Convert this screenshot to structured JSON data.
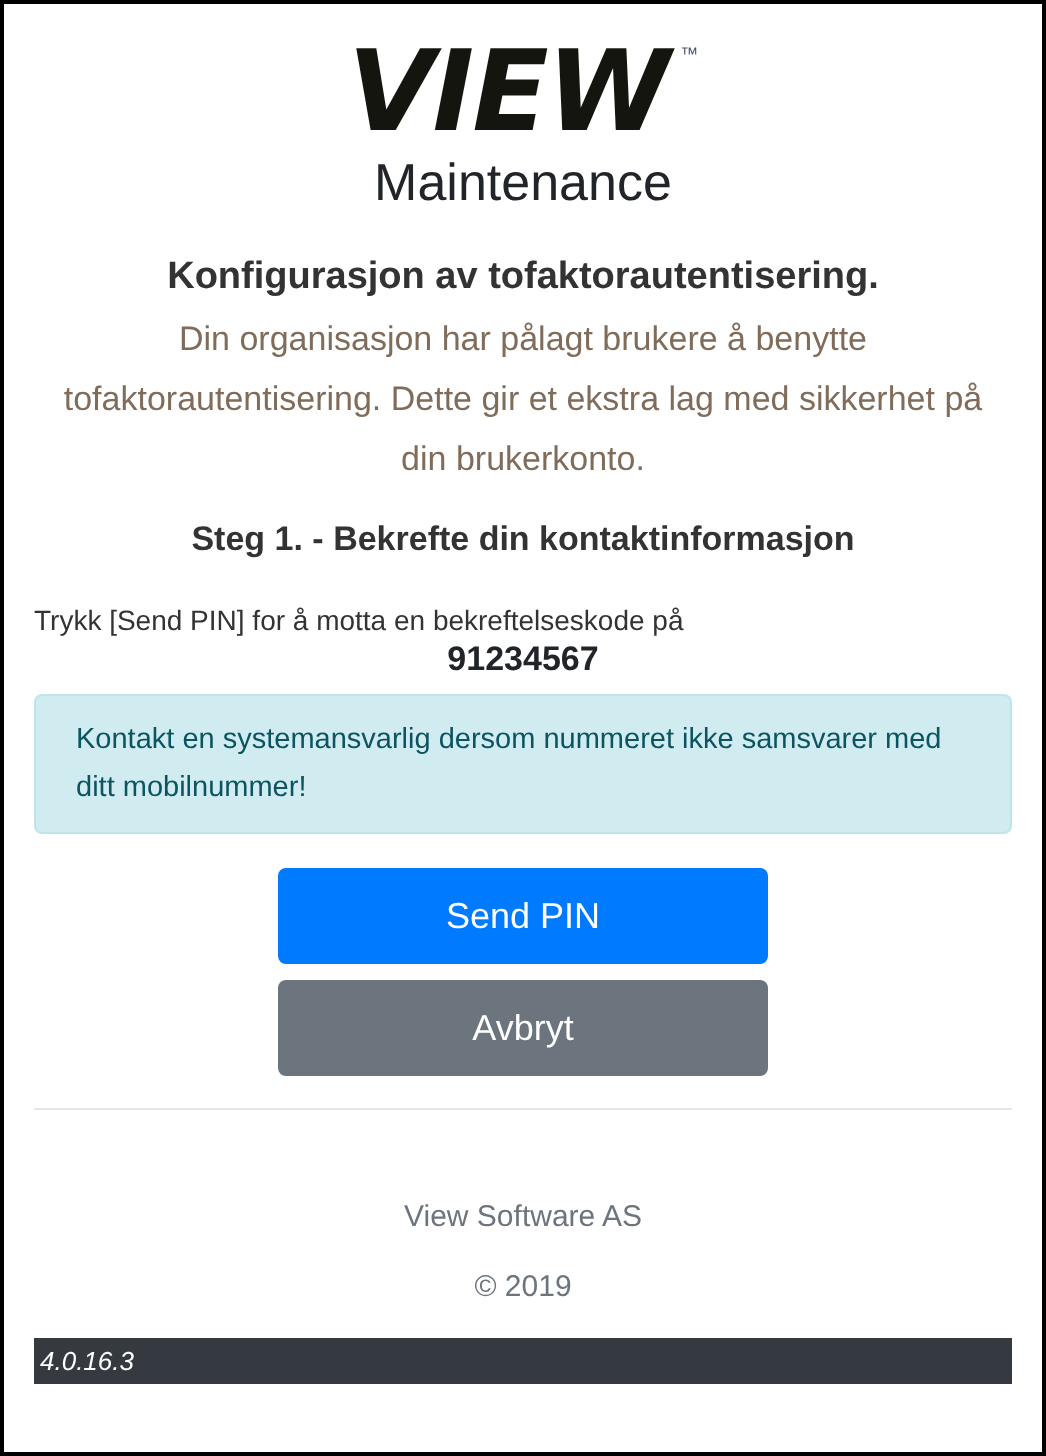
{
  "logo": {
    "text": "VIEW",
    "trademark": "™"
  },
  "app_name": "Maintenance",
  "title": "Konfigurasjon av tofaktorautentisering.",
  "intro": "Din organisasjon har pålagt brukere å benytte tofaktorautentisering. Dette gir et ekstra lag med sikkerhet på din brukerkonto.",
  "step_heading": "Steg 1. - Bekrefte din kontaktinformasjon",
  "instruction": "Trykk [Send PIN] for å motta en bekreftelseskode på",
  "phone_number": "91234567",
  "alert": "Kontakt en systemansvarlig dersom nummeret ikke samsvarer med ditt mobilnummer!",
  "buttons": [
    {
      "label": "Send PIN",
      "kind": "primary"
    },
    {
      "label": "Avbryt",
      "kind": "secondary"
    }
  ],
  "footer": {
    "company": "View Software AS",
    "copyright": "© 2019"
  },
  "version": "4.0.16.3"
}
